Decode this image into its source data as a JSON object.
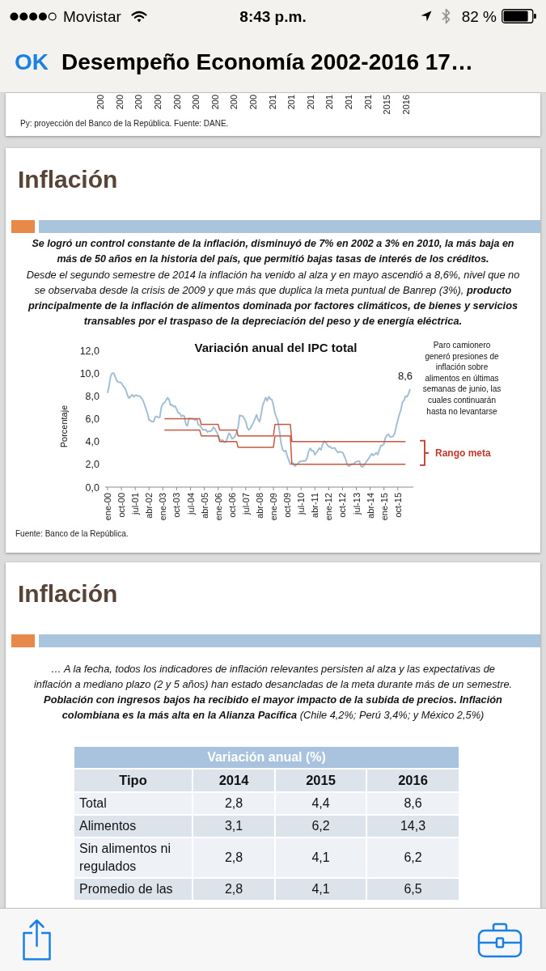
{
  "status_bar": {
    "carrier": "Movistar",
    "time": "8:43 p.m.",
    "battery": "82 %"
  },
  "nav_bar": {
    "back_button": "OK",
    "title": "Desempeño Economía 2002-2016 17…"
  },
  "slides": [
    {
      "kind": "fragment",
      "axis_labels": [
        "200",
        "200",
        "200",
        "200",
        "200",
        "200",
        "200",
        "200",
        "200",
        "201",
        "201",
        "201",
        "201",
        "201",
        "201",
        "2015",
        "2016"
      ],
      "footnote": "Py: proyección del Banco de la República. Fuente: DANE."
    },
    {
      "kind": "chart",
      "title": "Inflación",
      "paragraphs": [
        {
          "text": "Se logró un control constante de la inflación, disminuyó de 7% en 2002 a 3% en 2010, la más baja en más de 50 años en la historia del país, que permitió bajas tasas de interés de los créditos.",
          "bold": true
        },
        {
          "text": "Desde el segundo semestre de 2014 la inflación ha venido al alza y en mayo ascendió a 8,6%, nivel que no se observaba desde la crisis de 2009 y que más que duplica la meta puntual de Banrep (3%), **producto principalmente de la inflación de alimentos dominada por factores climáticos, de bienes y servicios transables por el traspaso de la depreciación del peso y de energía eléctrica.**",
          "bold": false
        }
      ],
      "chart_data": {
        "type": "line",
        "title": "Variación anual del IPC total",
        "ylabel": "Porcentaje",
        "categories": [
          "ene-00",
          null,
          null,
          null,
          null,
          null,
          null,
          null,
          null,
          "oct-00",
          null,
          null,
          null,
          null,
          null,
          null,
          null,
          null,
          "jul-01",
          null,
          null,
          null,
          null,
          null,
          null,
          null,
          null,
          "abr-02",
          null,
          null,
          null,
          null,
          null,
          null,
          null,
          null,
          "ene-03",
          null,
          null,
          null,
          null,
          null,
          null,
          null,
          null,
          "oct-03",
          null,
          null,
          null,
          null,
          null,
          null,
          null,
          null,
          "jul-04",
          null,
          null,
          null,
          null,
          null,
          null,
          null,
          null,
          "abr-05",
          null,
          null,
          null,
          null,
          null,
          null,
          null,
          null,
          "ene-06",
          null,
          null,
          null,
          null,
          null,
          null,
          null,
          null,
          "oct-06",
          null,
          null,
          null,
          null,
          null,
          null,
          null,
          null,
          "jul-07",
          null,
          null,
          null,
          null,
          null,
          null,
          null,
          null,
          "abr-08",
          null,
          null,
          null,
          null,
          null,
          null,
          null,
          null,
          "ene-09",
          null,
          null,
          null,
          null,
          null,
          null,
          null,
          null,
          "oct-09",
          null,
          null,
          null,
          null,
          null,
          null,
          null,
          null,
          "jul-10",
          null,
          null,
          null,
          null,
          null,
          null,
          null,
          null,
          "abr-11",
          null,
          null,
          null,
          null,
          null,
          null,
          null,
          null,
          "ene-12",
          null,
          null,
          null,
          null,
          null,
          null,
          null,
          null,
          "oct-12",
          null,
          null,
          null,
          null,
          null,
          null,
          null,
          null,
          "jul-13",
          null,
          null,
          null,
          null,
          null,
          null,
          null,
          null,
          "abr-14",
          null,
          null,
          null,
          null,
          null,
          null,
          null,
          null,
          "ene-15",
          null,
          null,
          null,
          null,
          null,
          null,
          null,
          null,
          "oct-15",
          null,
          null,
          null,
          null,
          null,
          null,
          null,
          null
        ],
        "series": [
          {
            "color": "#a3bfd6",
            "values": [
              8.25,
              8.91,
              9.73,
              10.0,
              10.0,
              9.68,
              9.33,
              9.22,
              9.2,
              9.14,
              8.89,
              8.75,
              8.49,
              8.04,
              7.81,
              7.97,
              8.1,
              7.93,
              8.04,
              8.06,
              7.98,
              7.98,
              7.83,
              7.65,
              7.26,
              6.86,
              6.46,
              5.89,
              5.84,
              5.73,
              5.75,
              6.15,
              6.21,
              6.12,
              6.11,
              6.99,
              7.31,
              7.41,
              7.6,
              7.85,
              7.69,
              7.19,
              7.22,
              7.05,
              7.11,
              6.82,
              6.5,
              6.49,
              6.2,
              6.3,
              6.21,
              5.5,
              5.37,
              6.06,
              6.0,
              6.0,
              5.97,
              5.89,
              5.97,
              5.5,
              5.43,
              5.25,
              5.03,
              5.02,
              5.05,
              4.83,
              4.91,
              4.9,
              5.02,
              5.27,
              5.1,
              4.85,
              4.56,
              4.19,
              4.11,
              4.12,
              3.95,
              3.94,
              4.32,
              4.72,
              4.58,
              4.24,
              4.31,
              4.48,
              4.78,
              5.25,
              6.3,
              6.26,
              6.23,
              6.03,
              5.77,
              5.22,
              5.01,
              5.16,
              5.41,
              5.69,
              6.0,
              6.35,
              5.93,
              5.73,
              6.39,
              7.18,
              7.52,
              7.87,
              7.57,
              7.94,
              7.73,
              7.67,
              7.18,
              6.47,
              6.14,
              5.73,
              4.85,
              3.81,
              3.28,
              3.13,
              3.21,
              2.72,
              2.37,
              2.0,
              2.1,
              2.09,
              1.84,
              1.98,
              2.07,
              2.25,
              2.24,
              2.31,
              2.28,
              2.33,
              2.59,
              3.17,
              3.4,
              3.17,
              3.19,
              2.84,
              3.02,
              3.23,
              3.42,
              3.27,
              3.73,
              4.02,
              3.96,
              3.73,
              3.54,
              3.55,
              3.4,
              3.43,
              3.44,
              3.2,
              3.03,
              3.11,
              3.08,
              3.06,
              2.77,
              2.44,
              2.0,
              1.83,
              1.91,
              2.02,
              2.0,
              2.16,
              2.22,
              2.27,
              2.27,
              1.84,
              1.76,
              1.94,
              2.13,
              2.32,
              2.51,
              2.72,
              2.93,
              2.79,
              2.89,
              3.02,
              2.86,
              3.29,
              3.65,
              3.66,
              3.82,
              4.36,
              4.56,
              4.64,
              4.41,
              4.42,
              4.46,
              4.74,
              5.35,
              5.89,
              6.39,
              6.77,
              7.45,
              7.59,
              7.98,
              7.93,
              8.2,
              8.6
            ]
          },
          {
            "color": "#c8573f",
            "values": [
              null,
              null,
              null,
              null,
              null,
              null,
              null,
              null,
              null,
              null,
              null,
              null,
              null,
              null,
              null,
              null,
              null,
              null,
              null,
              null,
              null,
              null,
              null,
              null,
              null,
              null,
              null,
              null,
              null,
              null,
              null,
              null,
              null,
              null,
              null,
              null,
              null,
              6,
              6,
              6,
              6,
              6,
              6,
              6,
              6,
              6,
              6,
              6,
              6,
              6,
              6,
              6,
              6,
              6,
              6,
              6,
              6,
              6,
              6,
              6,
              6,
              5.5,
              5.5,
              5.5,
              5.5,
              5.5,
              5.5,
              5.5,
              5.5,
              5.5,
              5.5,
              5.5,
              5.5,
              5,
              5,
              5,
              5,
              5,
              5,
              5,
              5,
              5,
              5,
              5,
              5,
              4.5,
              4.5,
              4.5,
              4.5,
              4.5,
              4.5,
              4.5,
              4.5,
              4.5,
              4.5,
              4.5,
              4.5,
              4.5,
              4.5,
              4.5,
              4.5,
              4.5,
              4.5,
              4.5,
              4.5,
              4.5,
              4.5,
              4.5,
              4.5,
              5.5,
              5.5,
              5.5,
              5.5,
              5.5,
              5.5,
              5.5,
              5.5,
              5.5,
              5.5,
              5.5,
              4,
              4,
              4,
              4,
              4,
              4,
              4,
              4,
              4,
              4,
              4,
              4,
              4,
              4,
              4,
              4,
              4,
              4,
              4,
              4,
              4,
              4,
              4,
              4,
              4,
              4,
              4,
              4,
              4,
              4,
              4,
              4,
              4,
              4,
              4,
              4,
              4,
              4,
              4,
              4,
              4,
              4,
              4,
              4,
              4,
              4,
              4,
              4,
              4,
              4,
              4,
              4,
              4,
              4,
              4,
              4,
              4,
              4,
              4,
              4,
              4,
              4,
              4,
              4,
              4,
              4,
              4,
              4,
              4,
              4,
              4,
              4,
              4,
              4,
              4,
              null,
              null,
              null
            ]
          },
          {
            "color": "#c8573f",
            "values": [
              null,
              null,
              null,
              null,
              null,
              null,
              null,
              null,
              null,
              null,
              null,
              null,
              null,
              null,
              null,
              null,
              null,
              null,
              null,
              null,
              null,
              null,
              null,
              null,
              null,
              null,
              null,
              null,
              null,
              null,
              null,
              null,
              null,
              null,
              null,
              null,
              null,
              5,
              5,
              5,
              5,
              5,
              5,
              5,
              5,
              5,
              5,
              5,
              5,
              5,
              5,
              5,
              5,
              5,
              5,
              5,
              5,
              5,
              5,
              5,
              5,
              4.5,
              4.5,
              4.5,
              4.5,
              4.5,
              4.5,
              4.5,
              4.5,
              4.5,
              4.5,
              4.5,
              4.5,
              4,
              4,
              4,
              4,
              4,
              4,
              4,
              4,
              4,
              4,
              4,
              4,
              3.5,
              3.5,
              3.5,
              3.5,
              3.5,
              3.5,
              3.5,
              3.5,
              3.5,
              3.5,
              3.5,
              3.5,
              3.5,
              3.5,
              3.5,
              3.5,
              3.5,
              3.5,
              3.5,
              3.5,
              3.5,
              3.5,
              3.5,
              3.5,
              4.5,
              4.5,
              4.5,
              4.5,
              4.5,
              4.5,
              4.5,
              4.5,
              4.5,
              4.5,
              4.5,
              2,
              2,
              2,
              2,
              2,
              2,
              2,
              2,
              2,
              2,
              2,
              2,
              2,
              2,
              2,
              2,
              2,
              2,
              2,
              2,
              2,
              2,
              2,
              2,
              2,
              2,
              2,
              2,
              2,
              2,
              2,
              2,
              2,
              2,
              2,
              2,
              2,
              2,
              2,
              2,
              2,
              2,
              2,
              2,
              2,
              2,
              2,
              2,
              2,
              2,
              2,
              2,
              2,
              2,
              2,
              2,
              2,
              2,
              2,
              2,
              2,
              2,
              2,
              2,
              2,
              2,
              2,
              2,
              2,
              2,
              2,
              2,
              2,
              2,
              2,
              null,
              null,
              null
            ]
          }
        ],
        "ylim": [
          0,
          12
        ],
        "yticks": [
          {
            "value": 0,
            "label": "0,0"
          },
          {
            "value": 2,
            "label": "2,0"
          },
          {
            "value": 4,
            "label": "4,0"
          },
          {
            "value": 6,
            "label": "6,0"
          },
          {
            "value": 8,
            "label": "8,0"
          },
          {
            "value": 10,
            "label": "10,0"
          },
          {
            "value": 12,
            "label": "12,0"
          }
        ],
        "annotations": [
          {
            "text": "8,6",
            "y": 8.6
          }
        ]
      },
      "chart_note": "Paro camionero generó presiones de inflación sobre alimentos en últimas semanas de junio, las cuales continuarán hasta no levantarse",
      "range_label": "Rango meta",
      "source": "Fuente: Banco de la República."
    },
    {
      "kind": "table",
      "title": "Inflación",
      "paragraphs": [
        {
          "text": "… A la fecha, todos los indicadores de inflación relevantes persisten al alza y las expectativas de inflación a mediano plazo (2 y 5 años) han estado desancladas de la meta durante más de un semestre. **Población con ingresos bajos ha recibido el mayor impacto de la subida de precios. Inflación colombiana es la más alta en la Alianza Pacífica** (Chile 4,2%; Perú 3,4%; y México 2,5%)",
          "bold": false
        }
      ],
      "table": {
        "caption": "Variación anual (%)",
        "columns": [
          "Tipo",
          "2014",
          "2015",
          "2016"
        ],
        "rows": [
          [
            "Total",
            "2,8",
            "4,4",
            "8,6"
          ],
          [
            "Alimentos",
            "3,1",
            "6,2",
            "14,3"
          ],
          [
            "Sin alimentos ni regulados",
            "2,8",
            "4,1",
            "6,2"
          ],
          [
            "Promedio de las",
            "2,8",
            "4,1",
            "6,5"
          ]
        ]
      }
    }
  ]
}
